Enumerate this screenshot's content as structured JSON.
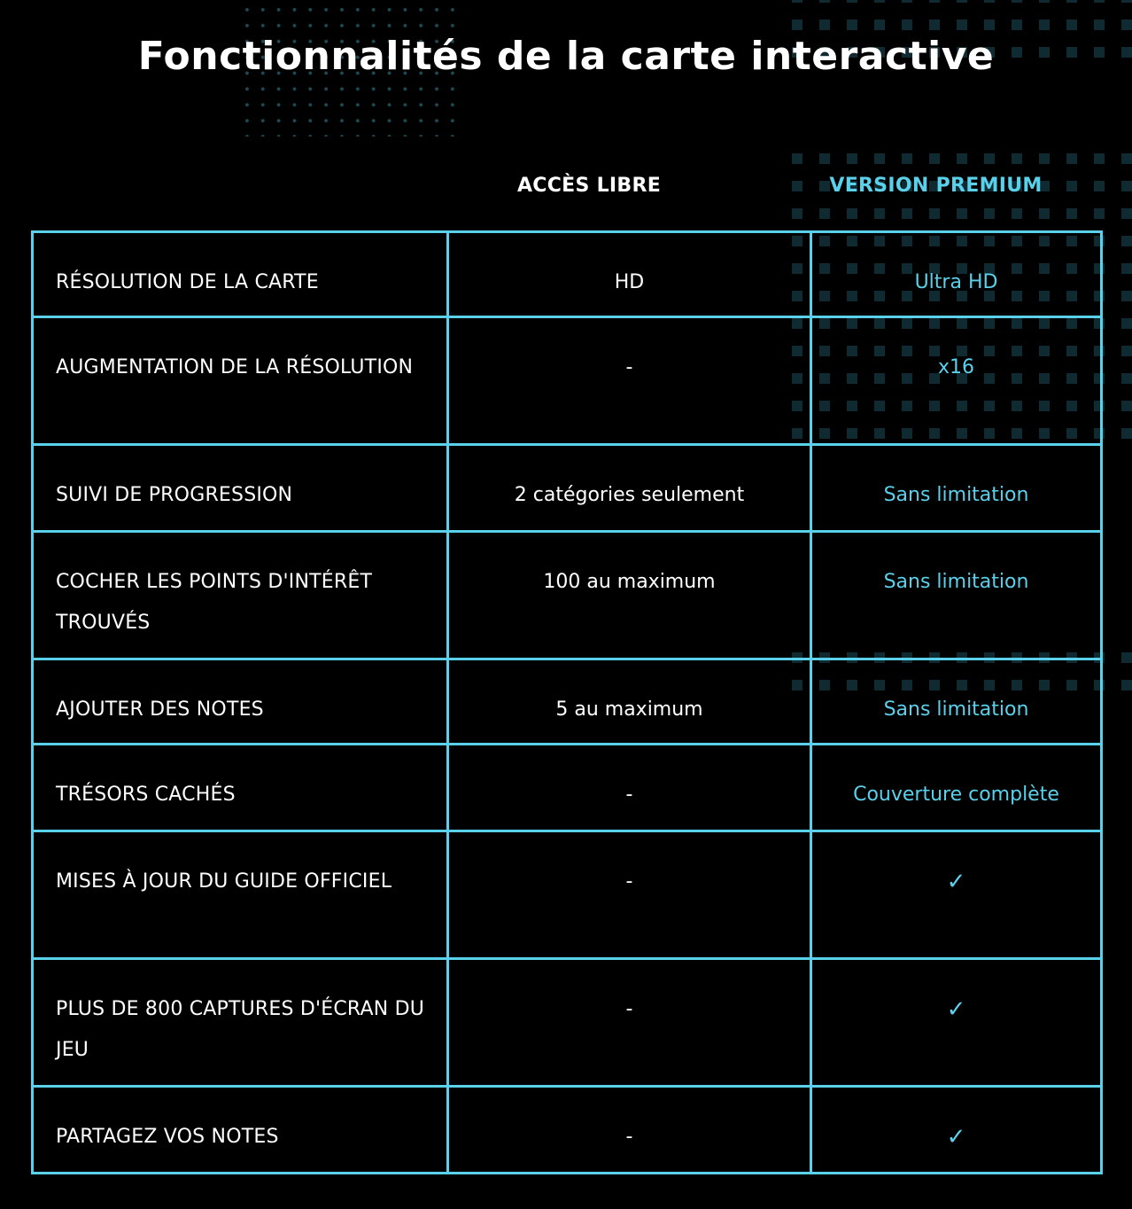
{
  "page": {
    "title": "Fonctionnalités de la carte interactive"
  },
  "columns": {
    "free": "ACCÈS LIBRE",
    "premium": "VERSION PREMIUM"
  },
  "colors": {
    "accent": "#5ad0ea",
    "background": "#000000",
    "text": "#ffffff",
    "pattern": "#0f2a31"
  },
  "rows": [
    {
      "feature": "RÉSOLUTION DE LA CARTE",
      "free": "HD",
      "premium": "Ultra HD",
      "premium_icon": null
    },
    {
      "feature": "AUGMENTATION DE LA RÉSOLUTION",
      "free": "-",
      "premium": "x16",
      "premium_icon": null
    },
    {
      "feature": "SUIVI DE PROGRESSION",
      "free": "2 catégories seulement",
      "premium": "Sans limitation",
      "premium_icon": null
    },
    {
      "feature": "COCHER LES POINTS D'INTÉRÊT TROUVÉS",
      "free": "100 au maximum",
      "premium": "Sans limitation",
      "premium_icon": null
    },
    {
      "feature": "AJOUTER DES NOTES",
      "free": "5 au maximum",
      "premium": "Sans limitation",
      "premium_icon": null
    },
    {
      "feature": "TRÉSORS CACHÉS",
      "free": "-",
      "premium": "Couverture complète",
      "premium_icon": null
    },
    {
      "feature": "MISES À JOUR DU GUIDE OFFICIEL",
      "free": "-",
      "premium": "✓",
      "premium_icon": "checkmark-icon"
    },
    {
      "feature": "PLUS DE 800 CAPTURES D'ÉCRAN DU JEU",
      "free": "-",
      "premium": "✓",
      "premium_icon": "checkmark-icon"
    },
    {
      "feature": "PARTAGEZ VOS NOTES",
      "free": "-",
      "premium": "✓",
      "premium_icon": "checkmark-icon"
    }
  ]
}
